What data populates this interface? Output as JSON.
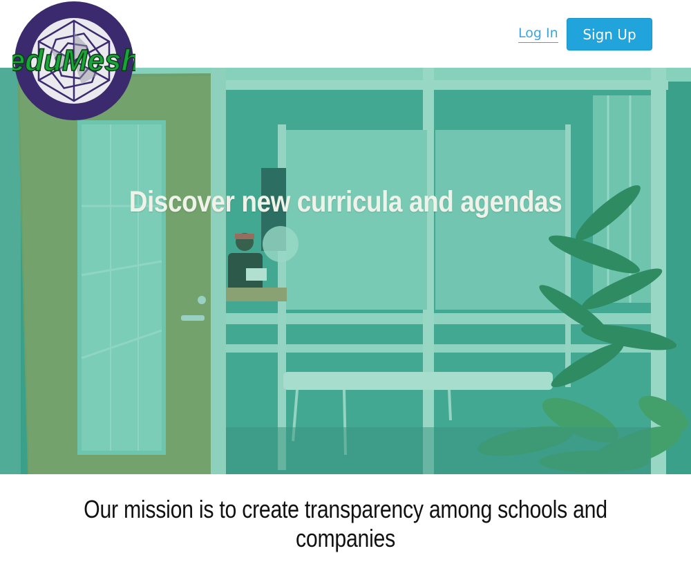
{
  "brand": {
    "name": "eduMesh"
  },
  "header": {
    "login_label": "Log In",
    "signup_label": "Sign Up"
  },
  "hero": {
    "title": "Discover new curricula and agendas"
  },
  "mission": {
    "text": "Our mission is to create transparency among schools and companies"
  },
  "colors": {
    "accent": "#21a3db",
    "logo_purple": "#3b2a6e",
    "logo_green": "#1aa53a",
    "hero_tint": "#2fb59a"
  }
}
